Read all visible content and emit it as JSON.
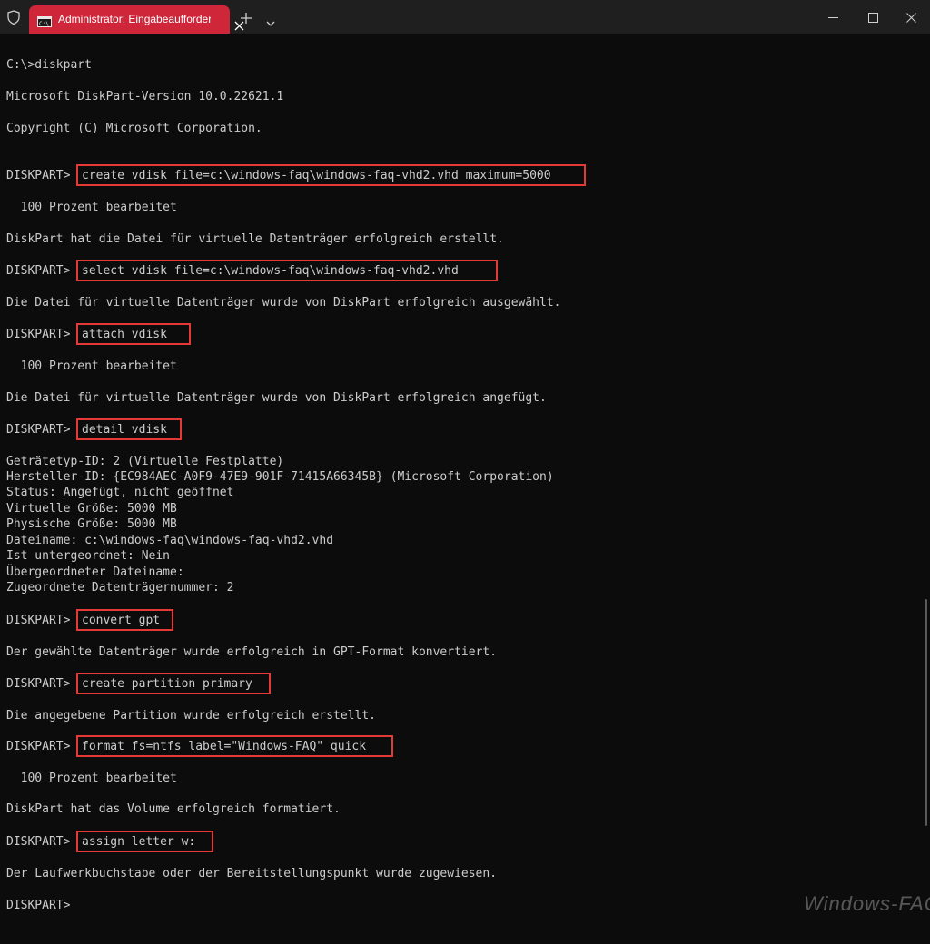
{
  "window": {
    "tab_title": "Administrator: Eingabeaufforderung",
    "accent_color": "#d0263a",
    "highlight_color": "#e53935"
  },
  "console": {
    "prompt": "DISKPART>",
    "lines": {
      "l1": "C:\\>diskpart",
      "l2": "Microsoft DiskPart-Version 10.0.22621.1",
      "l3": "Copyright (C) Microsoft Corporation.",
      "l5": "  100 Prozent bearbeitet",
      "l6": "DiskPart hat die Datei für virtuelle Datenträger erfolgreich erstellt.",
      "l8": "Die Datei für virtuelle Datenträger wurde von DiskPart erfolgreich ausgewählt.",
      "l10": "  100 Prozent bearbeitet",
      "l11": "Die Datei für virtuelle Datenträger wurde von DiskPart erfolgreich angefügt.",
      "d1": "Geträtetyp-ID: 2 (Virtuelle Festplatte)",
      "d2": "Hersteller-ID: {EC984AEC-A0F9-47E9-901F-71415A66345B} (Microsoft Corporation)",
      "d3": "Status: Angefügt, nicht geöffnet",
      "d4": "Virtuelle Größe: 5000 MB",
      "d5": "Physische Größe: 5000 MB",
      "d6": "Dateiname: c:\\windows-faq\\windows-faq-vhd2.vhd",
      "d7": "Ist untergeordnet: Nein",
      "d8": "Übergeordneter Dateiname:",
      "d9": "Zugeordnete Datenträgernummer: 2",
      "l14": "Der gewählte Datenträger wurde erfolgreich in GPT-Format konvertiert.",
      "l16": "Die angegebene Partition wurde erfolgreich erstellt.",
      "l18": "  100 Prozent bearbeitet",
      "l19": "DiskPart hat das Volume erfolgreich formatiert.",
      "l21": "Der Laufwerkbuchstabe oder der Bereitstellungspunkt wurde zugewiesen."
    },
    "commands": {
      "c1": "create vdisk file=c:\\windows-faq\\windows-faq-vhd2.vhd maximum=5000",
      "c2": "select vdisk file=c:\\windows-faq\\windows-faq-vhd2.vhd",
      "c3": "attach vdisk",
      "c4": "detail vdisk",
      "c5": "convert gpt",
      "c6": "create partition primary",
      "c7": "format fs=ntfs label=\"Windows-FAQ\" quick",
      "c8": "assign letter w:"
    }
  },
  "watermark": "Windows-FAQ",
  "icons": {
    "shield": "shield-icon",
    "cmd": "cmd-icon",
    "close_tab": "close-icon",
    "new_tab": "plus-icon",
    "dropdown": "chevron-down-icon",
    "minimize": "minimize-icon",
    "maximize": "maximize-icon",
    "close_window": "close-icon"
  }
}
